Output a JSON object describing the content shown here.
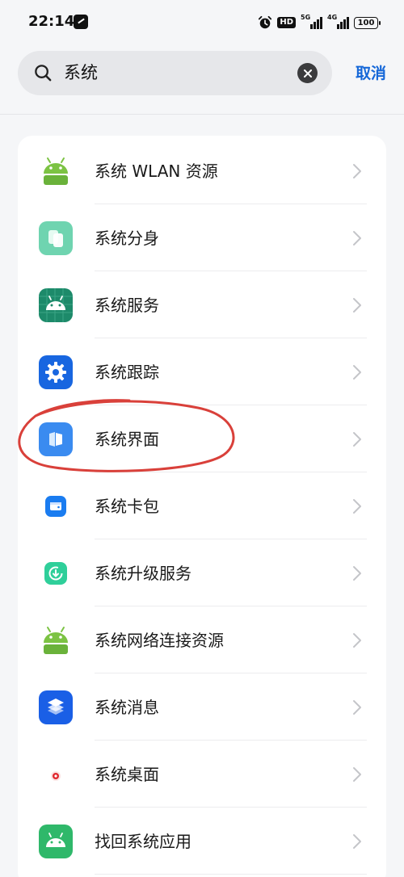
{
  "status_bar": {
    "time": "22:14",
    "hd_label": "HD",
    "network_1": "5G",
    "network_2": "4G",
    "battery": "100"
  },
  "search": {
    "query": "系统",
    "cancel_label": "取消"
  },
  "results": [
    {
      "label": "系统 WLAN 资源",
      "icon": "android-robot-icon"
    },
    {
      "label": "系统分身",
      "icon": "clone-pages-icon"
    },
    {
      "label": "系统服务",
      "icon": "android-grid-icon"
    },
    {
      "label": "系统跟踪",
      "icon": "gear-icon"
    },
    {
      "label": "系统界面",
      "icon": "ui-panels-icon"
    },
    {
      "label": "系统卡包",
      "icon": "wallet-icon"
    },
    {
      "label": "系统升级服务",
      "icon": "update-arrow-icon"
    },
    {
      "label": "系统网络连接资源",
      "icon": "android-robot-icon"
    },
    {
      "label": "系统消息",
      "icon": "layers-icon"
    },
    {
      "label": "系统桌面",
      "icon": "desktop-dot-icon"
    },
    {
      "label": "找回系统应用",
      "icon": "android-robot-icon"
    }
  ],
  "colors": {
    "accent": "#1567d8",
    "annotation": "#d9403a",
    "android_green": "#7cc343"
  }
}
